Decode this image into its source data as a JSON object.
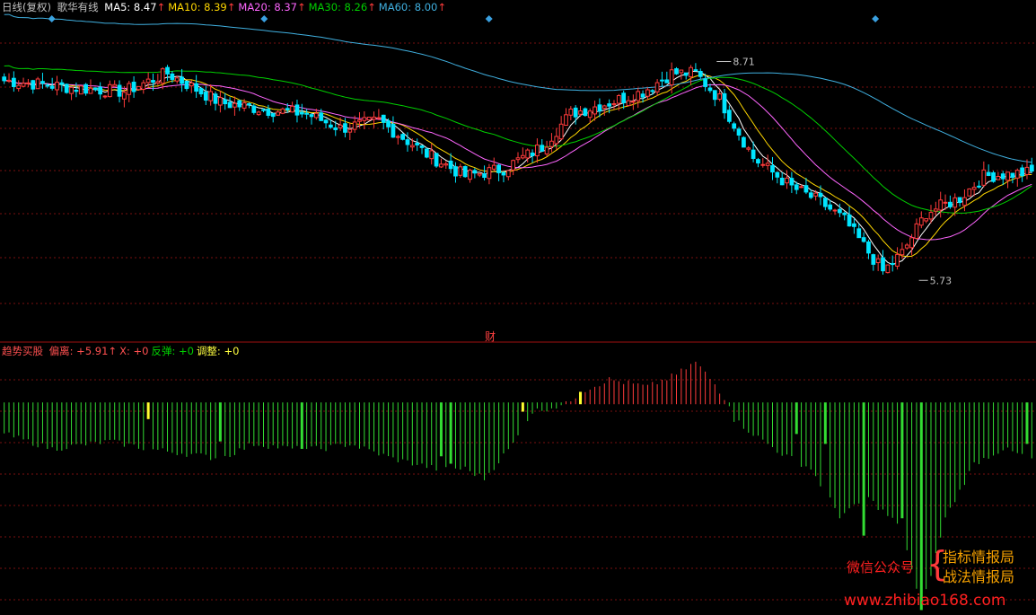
{
  "legend": {
    "period": "日线(复权)",
    "stock": "歌华有线",
    "ma": [
      {
        "label": "MA5:",
        "value": "8.47",
        "color": "#ffffff"
      },
      {
        "label": "MA10:",
        "value": "8.39",
        "color": "#ffd700"
      },
      {
        "label": "MA20:",
        "value": "8.37",
        "color": "#ff66ff"
      },
      {
        "label": "MA30:",
        "value": "8.26",
        "color": "#00d000"
      },
      {
        "label": "MA60:",
        "value": "8.00",
        "color": "#40b0e0"
      }
    ],
    "arrow": "↑"
  },
  "indicator_legend": {
    "name": "趋势买股",
    "items": [
      {
        "label": "偏离:",
        "value": "+5.91",
        "arrow": "↑",
        "color": "#ff5050"
      },
      {
        "label": "X:",
        "value": "+0",
        "arrow": "",
        "color": "#ff5050"
      },
      {
        "label": "反弹:",
        "value": "+0",
        "arrow": "",
        "color": "#00d000"
      },
      {
        "label": "调整:",
        "value": "+0",
        "arrow": "",
        "color": "#ffff40"
      }
    ]
  },
  "annotations": {
    "high_label": "8.71",
    "low_label": "5.73",
    "cai": "财"
  },
  "watermark": {
    "wechat": "微信公众号",
    "brand1": "指标情报局",
    "brand2": "战法情报局",
    "url": "www.zhibiao168.com"
  },
  "colors": {
    "up": "#ff3b3b",
    "down": "#00e5ff",
    "ma5": "#ffffff",
    "ma10": "#ffd700",
    "ma20": "#ff66ff",
    "ma30": "#00d000",
    "ma60": "#40b0e0",
    "ind_red": "#ff3b3b",
    "ind_green": "#33dd33",
    "ind_yellow": "#ffff30"
  },
  "chart_data": {
    "type": "candlestick",
    "price_range": [
      5.0,
      9.4
    ],
    "high": 8.71,
    "low": 5.73,
    "markers": [
      0.05,
      0.255,
      0.472,
      0.845
    ],
    "candle_anchors": [
      [
        0,
        8.45
      ],
      [
        15,
        8.35
      ],
      [
        25,
        8.3
      ],
      [
        34,
        8.55
      ],
      [
        45,
        8.15
      ],
      [
        55,
        8.05
      ],
      [
        63,
        8.0
      ],
      [
        70,
        7.8
      ],
      [
        78,
        7.9
      ],
      [
        88,
        7.45
      ],
      [
        96,
        7.15
      ],
      [
        104,
        7.25
      ],
      [
        112,
        7.55
      ],
      [
        118,
        8.0
      ],
      [
        126,
        8.15
      ],
      [
        133,
        8.3
      ],
      [
        139,
        8.55
      ],
      [
        144,
        8.55
      ],
      [
        149,
        8.2
      ],
      [
        156,
        7.4
      ],
      [
        164,
        7.0
      ],
      [
        170,
        6.8
      ],
      [
        175,
        6.55
      ],
      [
        179,
        6.2
      ],
      [
        183,
        5.85
      ],
      [
        187,
        6.1
      ],
      [
        192,
        6.65
      ],
      [
        199,
        6.85
      ],
      [
        204,
        7.15
      ],
      [
        214,
        7.2
      ]
    ],
    "indicator": {
      "range": [
        -8.5,
        2.0
      ],
      "anchors": [
        [
          0,
          -1.2
        ],
        [
          10,
          -1.8
        ],
        [
          22,
          -1.5
        ],
        [
          30,
          -1.8
        ],
        [
          38,
          -2.0
        ],
        [
          45,
          -2.2
        ],
        [
          52,
          -1.6
        ],
        [
          60,
          -1.8
        ],
        [
          66,
          -1.8
        ],
        [
          72,
          -1.6
        ],
        [
          81,
          -2.2
        ],
        [
          90,
          -2.6
        ],
        [
          96,
          -2.6
        ],
        [
          100,
          -3.0
        ],
        [
          106,
          -1.6
        ],
        [
          110,
          -0.3
        ],
        [
          117,
          0.0
        ],
        [
          120,
          0.5
        ],
        [
          126,
          1.0
        ],
        [
          134,
          0.7
        ],
        [
          140,
          1.2
        ],
        [
          144,
          1.7
        ],
        [
          148,
          0.8
        ],
        [
          151,
          0.0
        ],
        [
          152,
          -0.6
        ],
        [
          156,
          -1.2
        ],
        [
          162,
          -2.0
        ],
        [
          168,
          -2.6
        ],
        [
          174,
          -4.5
        ],
        [
          180,
          -3.8
        ],
        [
          187,
          -5.0
        ],
        [
          191,
          -8.3
        ],
        [
          196,
          -4.6
        ],
        [
          202,
          -2.4
        ],
        [
          208,
          -1.8
        ],
        [
          214,
          -2.2
        ]
      ],
      "highlight": [
        [
          30,
          "yellow",
          -0.6
        ],
        [
          45,
          "green",
          -1.5
        ],
        [
          62,
          "green",
          -1.8
        ],
        [
          91,
          "green",
          -2.1
        ],
        [
          93,
          "green",
          -2.4
        ],
        [
          108,
          "yellow",
          -0.3
        ],
        [
          120,
          "yellow",
          0.5
        ],
        [
          165,
          "green",
          -1.2
        ],
        [
          171,
          "green",
          -1.6
        ],
        [
          179,
          "green",
          -5.3
        ],
        [
          187,
          "green",
          -4.6
        ],
        [
          191,
          "green",
          -8.3
        ],
        [
          213,
          "green",
          -1.6
        ]
      ]
    }
  }
}
